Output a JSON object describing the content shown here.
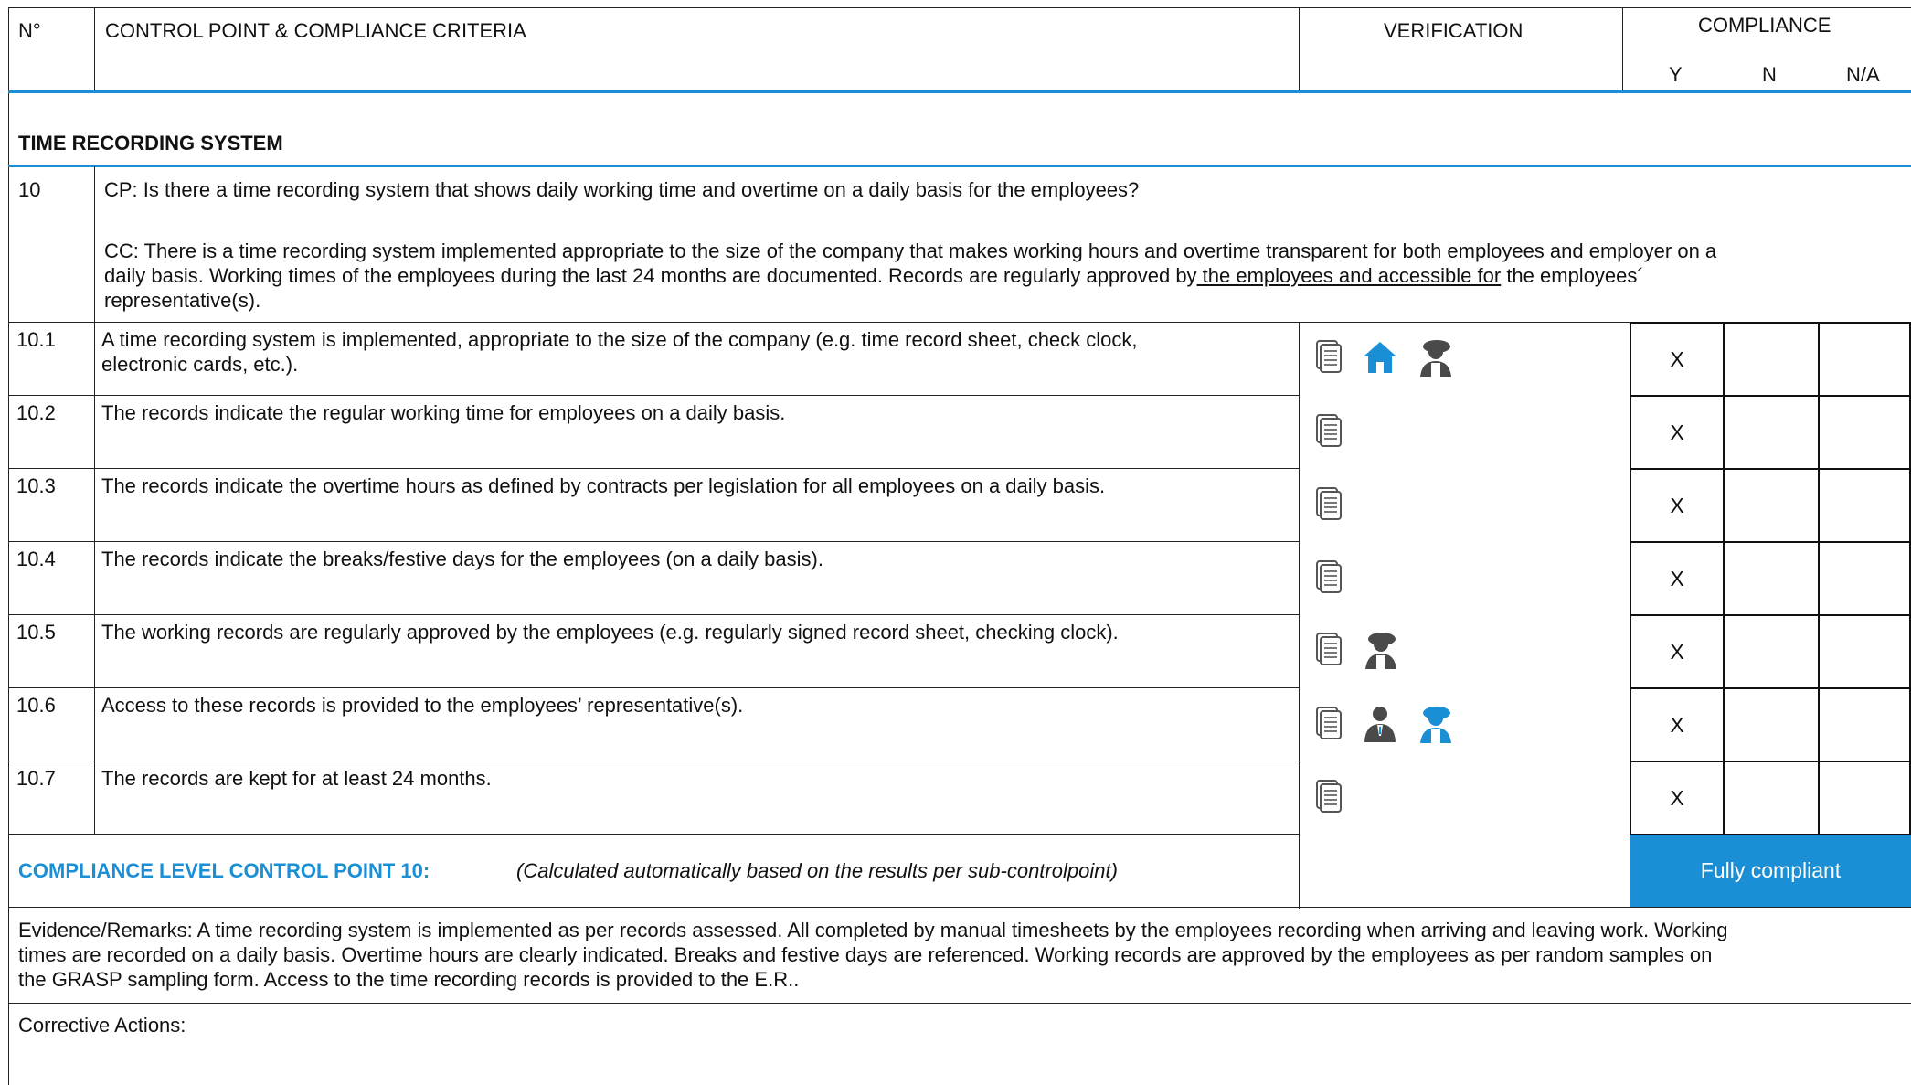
{
  "header": {
    "no": "N°",
    "cp": "CONTROL POINT & COMPLIANCE CRITERIA",
    "verification": "VERIFICATION",
    "compliance": "COMPLIANCE",
    "y": "Y",
    "n": "N",
    "na": "N/A"
  },
  "section": {
    "title": "TIME RECORDING SYSTEM"
  },
  "cp10": {
    "no": "10",
    "question": "CP: Is there a time recording system that shows daily working time and overtime on a daily basis for the employees?",
    "criteria_1": "CC: There is a time recording system implemented appropriate to the size of the company that makes working hours and overtime transparent for both employees and employer on a",
    "criteria_2a": "daily basis. Working times of the employees during the last 24 months are documented. Records are regularly approved by",
    "criteria_2b": " the employees and accessible for",
    "criteria_2c": " the employees´",
    "criteria_3": "representative(s)."
  },
  "rows": [
    {
      "no": "10.1",
      "text": "A time recording system is implemented, appropriate to the size of the company (e.g. time record sheet, check clock,",
      "text2": "electronic cards, etc.).",
      "y": "X",
      "n": "",
      "na": ""
    },
    {
      "no": "10.2",
      "text": "The records indicate the regular working time for employees on a daily basis.",
      "y": "X",
      "n": "",
      "na": ""
    },
    {
      "no": "10.3",
      "text": "The records indicate the overtime hours as defined by contracts per legislation for all employees on a daily basis.",
      "y": "X",
      "n": "",
      "na": ""
    },
    {
      "no": "10.4",
      "text": "The records indicate the breaks/festive days for the employees (on a daily basis).",
      "y": "X",
      "n": "",
      "na": ""
    },
    {
      "no": "10.5",
      "text": "The working records are regularly approved by the employees (e.g. regularly signed record sheet, checking clock).",
      "y": "X",
      "n": "",
      "na": ""
    },
    {
      "no": "10.6",
      "text": "Access to these records is provided to the employees’ representative(s).",
      "y": "X",
      "n": "",
      "na": ""
    },
    {
      "no": "10.7",
      "text": "The records are kept for at least 24 months.",
      "y": "X",
      "n": "",
      "na": ""
    }
  ],
  "icons": {
    "doc": "document-stack-icon",
    "home": "house-icon",
    "worker": "worker-icon",
    "manager": "manager-icon"
  },
  "compliance_level": {
    "label": "COMPLIANCE LEVEL CONTROL POINT 10:",
    "note": "(Calculated automatically based on the results per sub-controlpoint)",
    "result": "Fully compliant"
  },
  "evidence": {
    "line1": "Evidence/Remarks: A time recording system is implemented as per records assessed. All completed by manual timesheets by the employees recording when arriving and leaving work. Working",
    "line2": "times are recorded on a daily basis. Overtime hours are clearly indicated. Breaks and festive days are referenced. Working records are approved by the employees as per random samples on",
    "line3": "the GRASP sampling form. Access to the time recording records is provided to the E.R.."
  },
  "corrective": {
    "label": "Corrective Actions:"
  },
  "colors": {
    "accent": "#1a8fd6",
    "icon_gray": "#4a4a4a"
  }
}
